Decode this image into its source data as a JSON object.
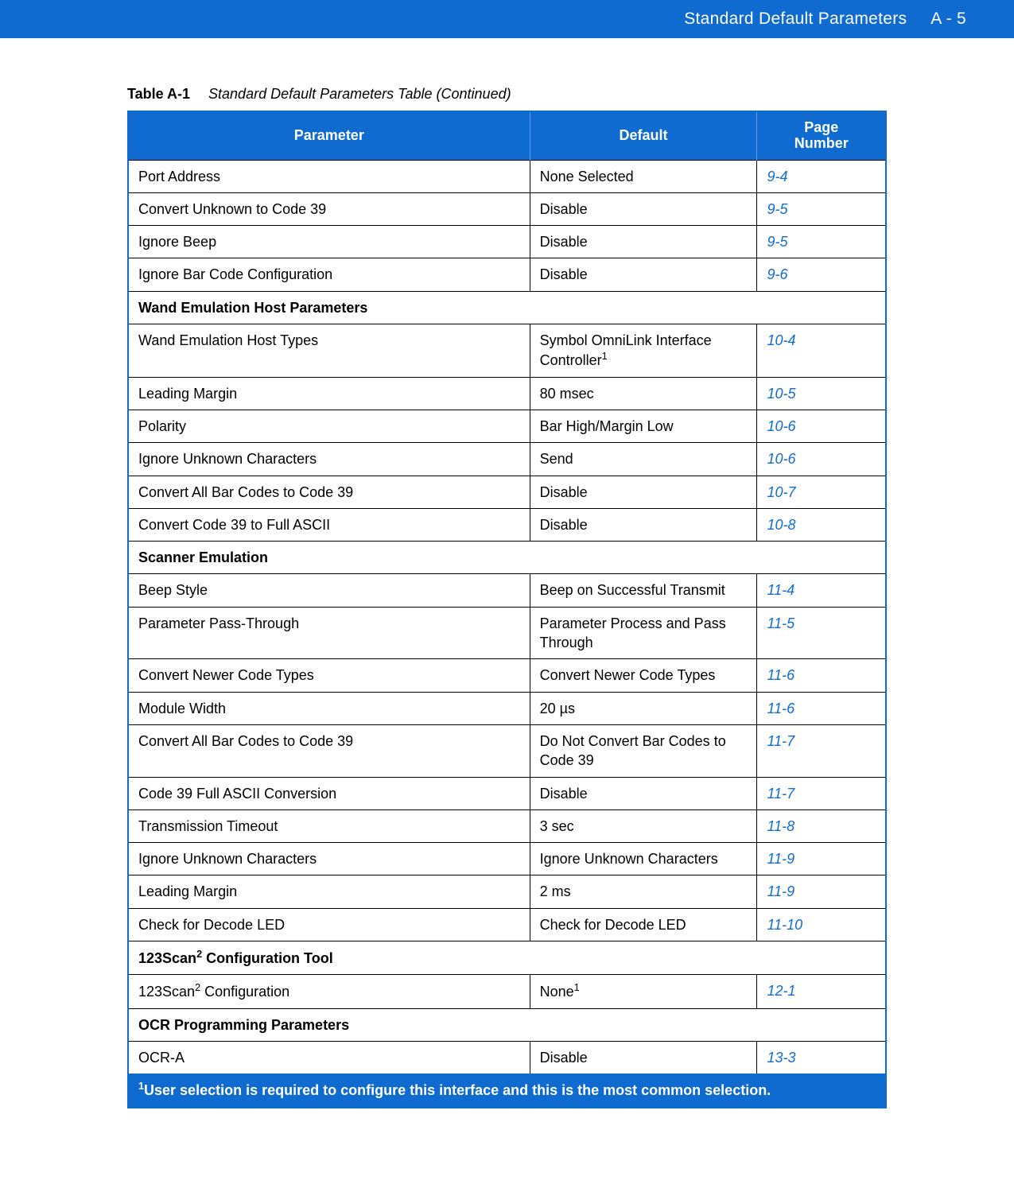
{
  "header": {
    "section_title": "Standard Default Parameters",
    "page_label": "A - 5"
  },
  "caption": {
    "id": "Table A-1",
    "title": "Standard Default Parameters Table (Continued)"
  },
  "columns": {
    "param": "Parameter",
    "default": "Default",
    "page_line1": "Page",
    "page_line2": "Number"
  },
  "rows": [
    {
      "type": "data",
      "param": "Port Address",
      "default": "None Selected",
      "page": "9-4"
    },
    {
      "type": "data",
      "param": "Convert Unknown to Code 39",
      "default": "Disable",
      "page": "9-5"
    },
    {
      "type": "data",
      "param": "Ignore Beep",
      "default": "Disable",
      "page": "9-5"
    },
    {
      "type": "data",
      "param": "Ignore Bar Code Configuration",
      "default": "Disable",
      "page": "9-6"
    },
    {
      "type": "section",
      "label": "Wand Emulation Host Parameters"
    },
    {
      "type": "data",
      "param": "Wand Emulation Host Types",
      "default_pre": "Symbol OmniLink Interface Controller",
      "default_sup": "1",
      "page": "10-4"
    },
    {
      "type": "data",
      "param": "Leading Margin",
      "default": "80 msec",
      "page": "10-5"
    },
    {
      "type": "data",
      "param": "Polarity",
      "default": "Bar High/Margin Low",
      "page": "10-6"
    },
    {
      "type": "data",
      "param": "Ignore Unknown Characters",
      "default": "Send",
      "page": "10-6"
    },
    {
      "type": "data",
      "param": "Convert All Bar Codes to Code 39",
      "default": "Disable",
      "page": "10-7"
    },
    {
      "type": "data",
      "param": "Convert Code 39 to Full ASCII",
      "default": "Disable",
      "page": "10-8"
    },
    {
      "type": "section",
      "label": "Scanner Emulation"
    },
    {
      "type": "data",
      "param": "Beep Style",
      "default": "Beep on Successful Transmit",
      "page": "11-4"
    },
    {
      "type": "data",
      "param": "Parameter Pass-Through",
      "default": "Parameter Process and Pass Through",
      "page": "11-5"
    },
    {
      "type": "data",
      "param": "Convert Newer Code Types",
      "default": "Convert Newer Code Types",
      "page": "11-6"
    },
    {
      "type": "data",
      "param": "Module Width",
      "default": "20 µs",
      "page": "11-6"
    },
    {
      "type": "data",
      "param": "Convert All Bar Codes to Code 39",
      "default": "Do Not Convert Bar Codes to Code 39",
      "page": "11-7"
    },
    {
      "type": "data",
      "param": "Code 39 Full ASCII Conversion",
      "default": "Disable",
      "page": "11-7"
    },
    {
      "type": "data",
      "param": "Transmission Timeout",
      "default": "3 sec",
      "page": "11-8"
    },
    {
      "type": "data",
      "param": "Ignore Unknown Characters",
      "default": "Ignore Unknown Characters",
      "page": "11-9"
    },
    {
      "type": "data",
      "param": "Leading Margin",
      "default": "2 ms",
      "page": "11-9"
    },
    {
      "type": "data",
      "param": "Check for Decode LED",
      "default": "Check for Decode LED",
      "page": "11-10"
    },
    {
      "type": "section_sup",
      "pre": "123Scan",
      "sup": "2",
      "post": " Configuration Tool"
    },
    {
      "type": "data_sup_param",
      "param_pre": "123Scan",
      "param_sup": "2",
      "param_post": " Configuration",
      "default_pre": "None",
      "default_sup": "1",
      "page": "12-1"
    },
    {
      "type": "section",
      "label": "OCR Programming Parameters"
    },
    {
      "type": "data",
      "param": "OCR-A",
      "default": "Disable",
      "page": "13-3"
    }
  ],
  "footnote": {
    "sup": "1",
    "text": "User selection is required to configure this interface and this is the most common selection."
  }
}
